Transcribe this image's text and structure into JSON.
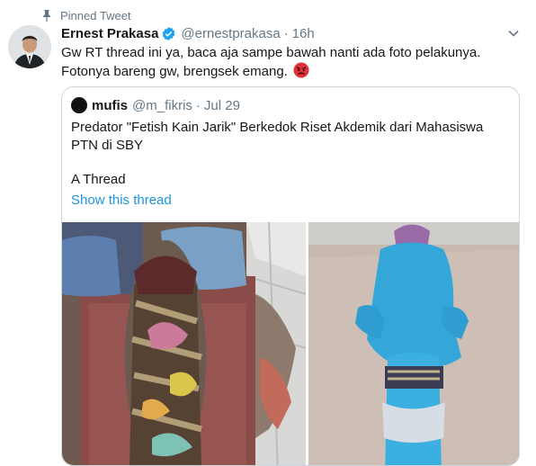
{
  "pinned": {
    "label": "Pinned Tweet",
    "icon": "pin-icon"
  },
  "author": {
    "name": "Ernest Prakasa",
    "handle": "@ernestprakasa",
    "time": "16h",
    "verified": true
  },
  "tweet": {
    "line1": "Gw RT thread ini ya, baca aja sampe bawah nanti ada foto pelakunya.",
    "line2": "Fotonya bareng gw, brengsek emang.",
    "emoji": "angry-face-emoji"
  },
  "quoted": {
    "name": "mufis",
    "handle": "@m_fikris",
    "time": "Jul 29",
    "text": "Predator \"Fetish Kain Jarik\" Berkedok Riset Akdemik dari Mahasiswa PTN di SBY",
    "thread_label": "A Thread",
    "show_thread": "Show this thread"
  },
  "colors": {
    "link": "#1b95e0",
    "secondary": "#657786",
    "verified": "#1da1f2",
    "border": "#ccd6dd"
  }
}
